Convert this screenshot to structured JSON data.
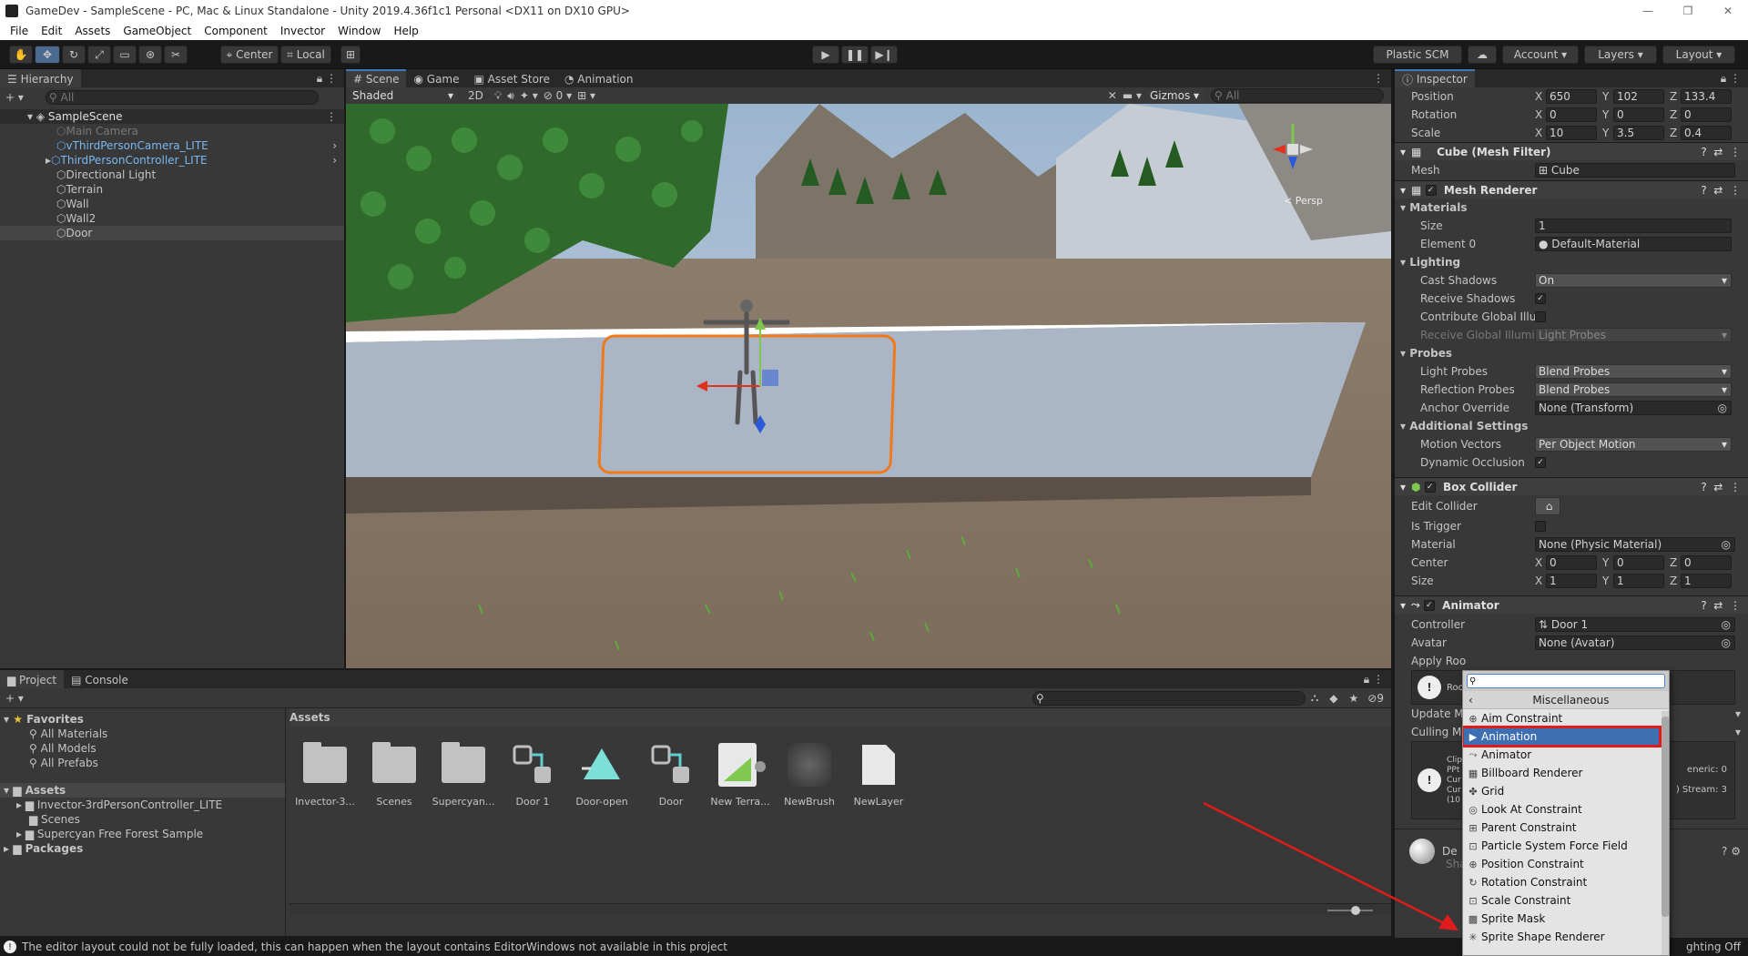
{
  "window": {
    "title": "GameDev - SampleScene - PC, Mac & Linux Standalone - Unity 2019.4.36f1c1 Personal <DX11 on DX10 GPU>"
  },
  "menu": [
    "File",
    "Edit",
    "Assets",
    "GameObject",
    "Component",
    "Invector",
    "Window",
    "Help"
  ],
  "toolbar": {
    "center_label": "Center",
    "local_label": "Local",
    "plastic_label": "Plastic SCM",
    "account_label": "Account",
    "layers_label": "Layers",
    "layout_label": "Layout"
  },
  "hierarchy": {
    "title": "Hierarchy",
    "search_placeholder": "All",
    "scene_name": "SampleScene",
    "items": [
      {
        "label": "Main Camera",
        "style": "disabled",
        "indent": 1
      },
      {
        "label": "vThirdPersonCamera_LITE",
        "style": "prefab",
        "indent": 1
      },
      {
        "label": "ThirdPersonController_LITE",
        "style": "prefab",
        "indent": 1
      },
      {
        "label": "Directional Light",
        "style": "normal",
        "indent": 1
      },
      {
        "label": "Terrain",
        "style": "normal",
        "indent": 1
      },
      {
        "label": "Wall",
        "style": "normal",
        "indent": 1
      },
      {
        "label": "Wall2",
        "style": "normal",
        "indent": 1
      },
      {
        "label": "Door",
        "style": "selected",
        "indent": 1
      }
    ]
  },
  "scene": {
    "tabs": [
      "Scene",
      "Game",
      "Asset Store",
      "Animation"
    ],
    "shading": "Shaded",
    "mode_2d": "2D",
    "fx_count": "0",
    "gizmos_label": "Gizmos",
    "search_placeholder": "All",
    "persp_label": "< Persp"
  },
  "inspector": {
    "title": "Inspector",
    "transform": {
      "position": {
        "label": "Position",
        "x": "650",
        "y": "102",
        "z": "133.4"
      },
      "rotation": {
        "label": "Rotation",
        "x": "0",
        "y": "0",
        "z": "0"
      },
      "scale": {
        "label": "Scale",
        "x": "10",
        "y": "3.5",
        "z": "0.4"
      }
    },
    "mesh_filter": {
      "title": "Cube (Mesh Filter)",
      "mesh_label": "Mesh",
      "mesh_value": "Cube"
    },
    "mesh_renderer": {
      "title": "Mesh Renderer",
      "materials": "Materials",
      "size_label": "Size",
      "size_value": "1",
      "element0_label": "Element 0",
      "element0_value": "Default-Material",
      "lighting": "Lighting",
      "cast_shadows_label": "Cast Shadows",
      "cast_shadows_value": "On",
      "receive_shadows_label": "Receive Shadows",
      "contrib_gi_label": "Contribute Global Illu",
      "receive_gi_label": "Receive Global Illumi",
      "receive_gi_value": "Light Probes",
      "probes": "Probes",
      "light_probes_label": "Light Probes",
      "light_probes_value": "Blend Probes",
      "reflection_probes_label": "Reflection Probes",
      "reflection_probes_value": "Blend Probes",
      "anchor_label": "Anchor Override",
      "anchor_value": "None (Transform)",
      "additional": "Additional Settings",
      "motion_vectors_label": "Motion Vectors",
      "motion_vectors_value": "Per Object Motion",
      "dynamic_occlusion_label": "Dynamic Occlusion"
    },
    "box_collider": {
      "title": "Box Collider",
      "edit_label": "Edit Collider",
      "trigger_label": "Is Trigger",
      "material_label": "Material",
      "material_value": "None (Physic Material)",
      "center_label": "Center",
      "center": {
        "x": "0",
        "y": "0",
        "z": "0"
      },
      "size_label": "Size",
      "size": {
        "x": "1",
        "y": "1",
        "z": "1"
      }
    },
    "animator": {
      "title": "Animator",
      "controller_label": "Controller",
      "controller_value": "Door 1",
      "avatar_label": "Avatar",
      "avatar_value": "None (Avatar)",
      "apply_root_label": "Apply Roo",
      "update_label": "Update M",
      "culling_label": "Culling M",
      "info_lines": [
        "Clip",
        "PPt",
        "Cur",
        "Cur",
        "(10"
      ],
      "right_info_1": "eneric: 0",
      "right_info_2": ") Stream: 3",
      "root_warn": "Roo",
      "mat_label": "De",
      "mat_sub": "Sha"
    }
  },
  "bottom_status_right": "ghting Off",
  "project": {
    "tabs": [
      "Project",
      "Console"
    ],
    "favorites": "Favorites",
    "fav_items": [
      "All Materials",
      "All Models",
      "All Prefabs"
    ],
    "assets_label": "Assets",
    "asset_folders": [
      "Invector-3rdPersonController_LITE",
      "Scenes",
      "Supercyan Free Forest Sample"
    ],
    "packages": "Packages",
    "breadcrumb": "Assets",
    "hidden_count": "9",
    "assets": [
      {
        "name": "Invector-3...",
        "kind": "folder"
      },
      {
        "name": "Scenes",
        "kind": "folder"
      },
      {
        "name": "Supercyan...",
        "kind": "folder"
      },
      {
        "name": "Door 1",
        "kind": "controller"
      },
      {
        "name": "Door-open",
        "kind": "anim"
      },
      {
        "name": "Door",
        "kind": "controller"
      },
      {
        "name": "New Terra...",
        "kind": "terrain"
      },
      {
        "name": "NewBrush",
        "kind": "brush"
      },
      {
        "name": "NewLayer",
        "kind": "file"
      }
    ]
  },
  "dropdown": {
    "search_value": "",
    "category": "Miscellaneous",
    "items": [
      {
        "label": "Aim Constraint",
        "icon": "aim-constraint-icon",
        "glyph": "⊕"
      },
      {
        "label": "Animation",
        "icon": "animation-icon",
        "glyph": "▶"
      },
      {
        "label": "Animator",
        "icon": "animator-icon",
        "glyph": "⤳"
      },
      {
        "label": "Billboard Renderer",
        "icon": "billboard-icon",
        "glyph": "▦"
      },
      {
        "label": "Grid",
        "icon": "grid-icon",
        "glyph": "✤"
      },
      {
        "label": "Look At Constraint",
        "icon": "look-at-constraint-icon",
        "glyph": "◎"
      },
      {
        "label": "Parent Constraint",
        "icon": "parent-constraint-icon",
        "glyph": "⊞"
      },
      {
        "label": "Particle System Force Field",
        "icon": "force-field-icon",
        "glyph": "⊡"
      },
      {
        "label": "Position Constraint",
        "icon": "position-constraint-icon",
        "glyph": "⊕"
      },
      {
        "label": "Rotation Constraint",
        "icon": "rotation-constraint-icon",
        "glyph": "↻"
      },
      {
        "label": "Scale Constraint",
        "icon": "scale-constraint-icon",
        "glyph": "⊡"
      },
      {
        "label": "Sprite Mask",
        "icon": "sprite-mask-icon",
        "glyph": "▩"
      },
      {
        "label": "Sprite Shape Renderer",
        "icon": "sprite-shape-icon",
        "glyph": "✳"
      }
    ]
  },
  "status_message": "The editor layout could not be fully loaded, this can happen when the layout contains EditorWindows not available in this project",
  "colors": {
    "accent": "#3a79bb",
    "highlight": "#e01b1b",
    "selection": "#2c5d87"
  }
}
